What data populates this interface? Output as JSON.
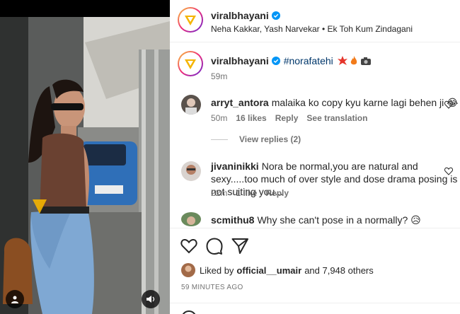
{
  "post": {
    "username": "viralbhayani",
    "audio": "Neha Kakkar, Yash Narvekar • Ek Toh Kum Zindagani",
    "caption_user": "viralbhayani",
    "caption_tag": "#norafatehi",
    "caption_time": "59m",
    "caption_emojis": [
      "explosion",
      "fire",
      "camera-flash"
    ]
  },
  "comments": [
    {
      "user": "arryt_antora",
      "text": "malaika ko copy kyu karne lagi behen ji 😂",
      "time": "50m",
      "likes": "16 likes",
      "reply": "Reply",
      "translate": "See translation"
    },
    {
      "user": "jivaninikki",
      "text": "Nora be normal,you are natural and sexy.....too much of over style and dose drama posing is not suiting you...",
      "time": "22m",
      "likes": "1 like",
      "reply": "Reply"
    },
    {
      "user": "scmithu8",
      "text": "Why she can't pose in a normally? 😥"
    }
  ],
  "view_replies": "View replies (2)",
  "liked_by": {
    "prefix": "Liked by",
    "user": "official__umair",
    "suffix": "and 7,948 others"
  },
  "time_ago": "59 MINUTES AGO",
  "colors": {
    "link": "#00376b",
    "muted": "#737373",
    "verified": "#0095f6",
    "brand_logo": "#f5b400"
  },
  "icons": [
    "heart-icon",
    "comment-icon",
    "share-icon",
    "user-tag-icon",
    "mute-icon",
    "verified-icon"
  ]
}
